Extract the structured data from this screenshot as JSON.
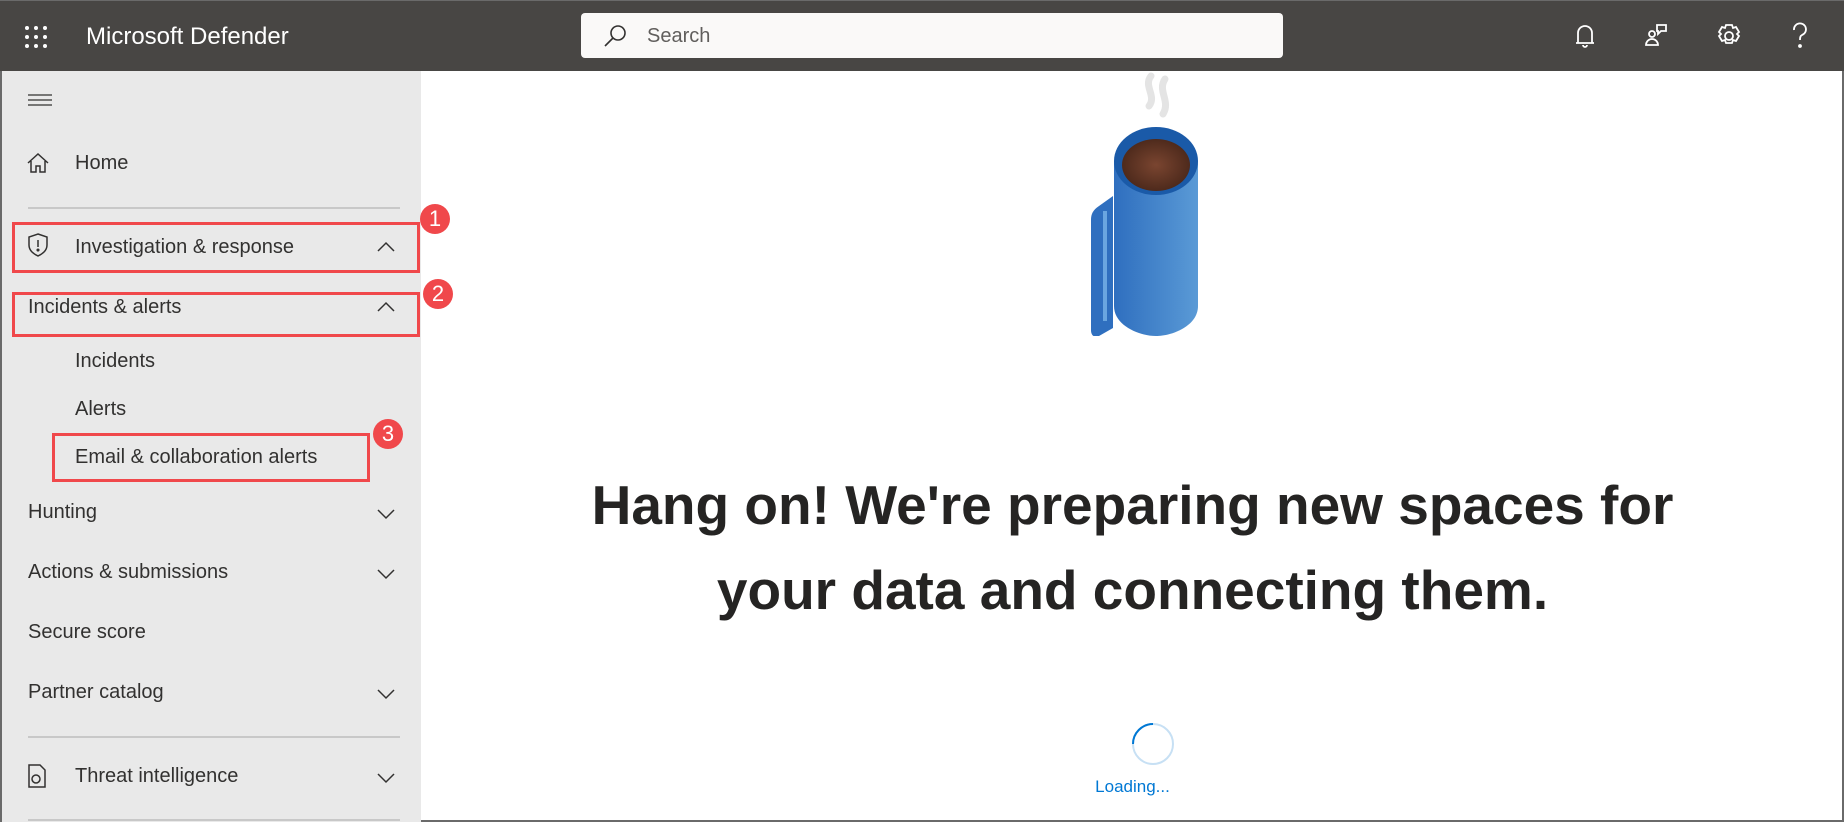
{
  "header": {
    "title": "Microsoft Defender",
    "search_placeholder": "Search",
    "icons": [
      "waffle-icon",
      "bell-icon",
      "feedback-icon",
      "gear-icon",
      "help-icon"
    ]
  },
  "sidebar": {
    "items": [
      {
        "label": "Home",
        "icon": "home-icon"
      },
      {
        "label": "Investigation & response",
        "icon": "shield-icon",
        "expanded": true,
        "annotation": "1"
      },
      {
        "label": "Incidents & alerts",
        "expanded": true,
        "annotation": "2"
      },
      {
        "label": "Incidents"
      },
      {
        "label": "Alerts"
      },
      {
        "label": "Email & collaboration alerts",
        "annotation": "3"
      },
      {
        "label": "Hunting"
      },
      {
        "label": "Actions & submissions"
      },
      {
        "label": "Secure score"
      },
      {
        "label": "Partner catalog"
      },
      {
        "label": "Threat intelligence",
        "icon": "threat-intel-icon"
      }
    ]
  },
  "main": {
    "heading_line1": "Hang on! We're preparing new spaces for",
    "heading_line2": "your data and connecting them.",
    "loading": "Loading..."
  },
  "colors": {
    "topbar": "#484644",
    "sidebar": "#e9e9e9",
    "annotation": "#f0484b",
    "accent": "#0078d4"
  }
}
